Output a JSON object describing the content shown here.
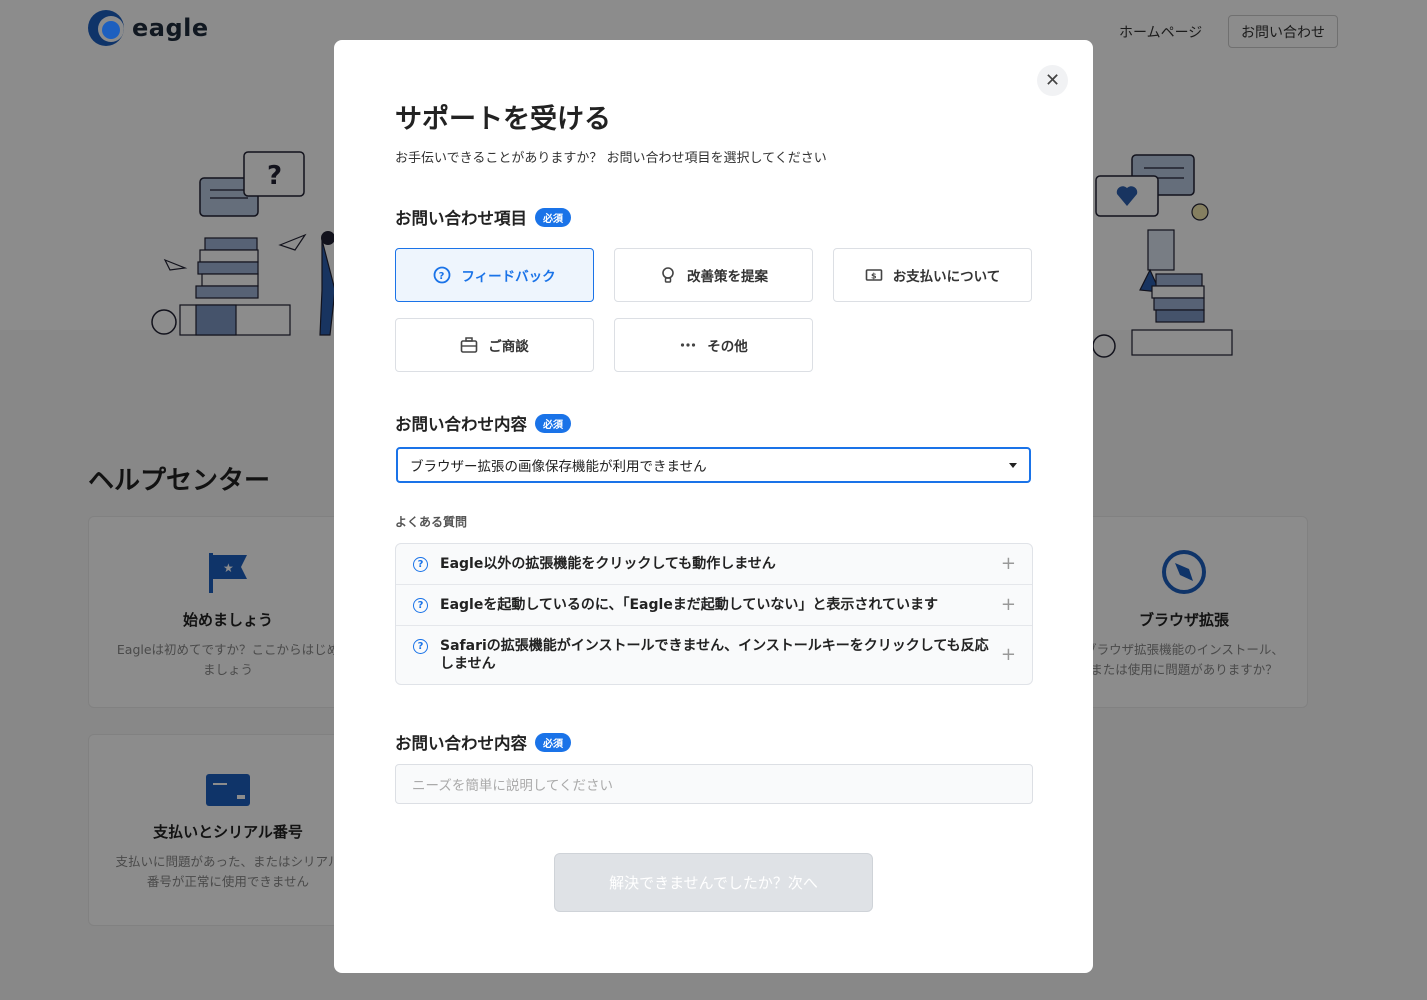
{
  "header": {
    "brand": "eagle",
    "nav_home": "ホームページ",
    "nav_contact": "お問い合わせ"
  },
  "help": {
    "title": "ヘルプセンター",
    "cards": [
      {
        "title": "始めましょう",
        "desc": "Eagleは初めてですか？ここからはじめましょう",
        "icon": "flag-icon"
      },
      {
        "title": "支払いとシリアル番号",
        "desc": "支払いに問題があった、またはシリアル番号が正常に使用できません",
        "icon": "credit-card-icon"
      },
      {
        "title": "ブラウザ拡張",
        "desc": "ブラウザ拡張機能のインストール、または使用に問題がありますか？",
        "icon": "compass-icon"
      }
    ]
  },
  "modal": {
    "title": "サポートを受ける",
    "subtitle": "お手伝いできることがありますか？ お問い合わせ項目を選択してください",
    "close_icon": "close-icon",
    "category_label": "お問い合わせ項目",
    "required_badge": "必須",
    "options": [
      {
        "label": "フィードバック",
        "icon": "question-circle-icon",
        "selected": true
      },
      {
        "label": "改善策を提案",
        "icon": "lightbulb-icon",
        "selected": false
      },
      {
        "label": "お支払いについて",
        "icon": "money-icon",
        "selected": false
      },
      {
        "label": "ご商談",
        "icon": "briefcase-icon",
        "selected": false
      },
      {
        "label": "その他",
        "icon": "ellipsis-icon",
        "selected": false
      }
    ],
    "topic_label": "お問い合わせ内容",
    "topic_value": "ブラウザー拡張の画像保存機能が利用できません",
    "faq_label": "よくある質問",
    "faq": [
      "Eagle以外の拡張機能をクリックしても動作しません",
      "Eagleを起動しているのに、「Eagleまだ起動していない」と表示されています",
      "Safariの拡張機能がインストールできません、インストールキーをクリックしても反応しません"
    ],
    "details_label": "お問い合わせ内容",
    "details_placeholder": "ニーズを簡単に説明してください",
    "next_button": "解決できませんでしたか？次へ"
  },
  "colors": {
    "accent": "#1a73e8",
    "brand": "#1d5fbf"
  }
}
